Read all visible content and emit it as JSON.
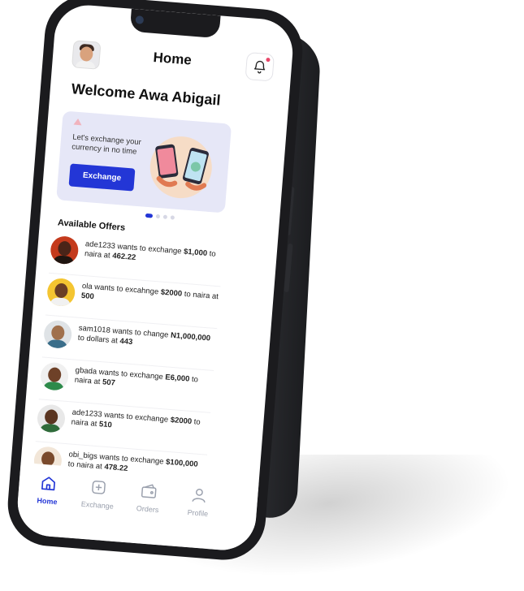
{
  "header": {
    "title": "Home"
  },
  "welcome": "Welcome Awa Abigail",
  "banner": {
    "text": "Let's exchange your currency in no time",
    "button_label": "Exchange"
  },
  "offers_title": "Available Offers",
  "offers": [
    {
      "user": "ade1233",
      "mid": " wants to exchange ",
      "amount": "$1,000",
      "to": " to naira at ",
      "rate": "462.22"
    },
    {
      "user": "ola",
      "mid": " wants to excahnge ",
      "amount": "$2000",
      "to": " to naira at ",
      "rate": "500"
    },
    {
      "user": "sam1018",
      "mid": " wants to change ",
      "amount": "N1,000,000",
      "to": " to dollars at ",
      "rate": "443"
    },
    {
      "user": "gbada",
      "mid": " wants to exchange ",
      "amount": "E6,000",
      "to": " to naira at ",
      "rate": "507"
    },
    {
      "user": "ade1233",
      "mid": " wants to exchange ",
      "amount": "$2000",
      "to": " to naira at ",
      "rate": "510"
    },
    {
      "user": "obi_bigs",
      "mid": " wants to exchange ",
      "amount": "$100,000",
      "to": " to naira at ",
      "rate": "478.22"
    }
  ],
  "nav": {
    "items": [
      {
        "label": "Home",
        "icon": "home-icon",
        "active": true
      },
      {
        "label": "Exchange",
        "icon": "plus-square-icon",
        "active": false
      },
      {
        "label": "Orders",
        "icon": "wallet-icon",
        "active": false
      },
      {
        "label": "Profile",
        "icon": "user-icon",
        "active": false
      }
    ]
  },
  "colors": {
    "accent": "#2336d6",
    "banner_bg": "#e6e7f7",
    "phone_body": "#1b1b1e"
  }
}
